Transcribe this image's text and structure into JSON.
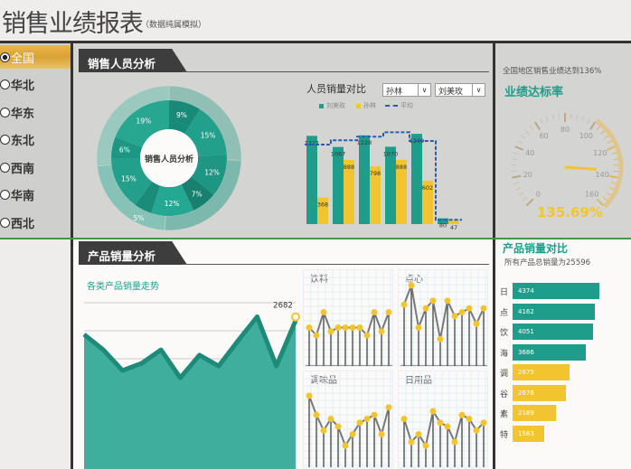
{
  "header": {
    "title": "销售业绩报表",
    "subtitle": "（数据纯属模拟）"
  },
  "sidebar": {
    "regions": [
      {
        "label": "全国",
        "selected": true
      },
      {
        "label": "华北"
      },
      {
        "label": "华东"
      },
      {
        "label": "东北"
      },
      {
        "label": "西南"
      },
      {
        "label": "华南"
      },
      {
        "label": "西北"
      }
    ]
  },
  "sales": {
    "section_title": "销售人员分析",
    "donut": {
      "center_label": "销售人员分析",
      "inner_slices": [
        9,
        15,
        12,
        7,
        12,
        5,
        15,
        6,
        19
      ],
      "labels": [
        "9%",
        "15%",
        "12%",
        "7%",
        "12%",
        "5%",
        "15%",
        "6%",
        "19%"
      ]
    },
    "compare": {
      "title": "人员销量对比",
      "select1": "孙林",
      "select2": "刘美玫",
      "legend": [
        "刘美玫",
        "孙林",
        "平均"
      ],
      "chart_data": {
        "type": "bar",
        "series": [
          {
            "name": "刘美玫",
            "values": [
              1221,
              1067,
              1228,
              1070,
              1249,
              80
            ]
          },
          {
            "name": "孙林",
            "values": [
              368,
              888,
              798,
              888,
              602,
              47
            ]
          },
          {
            "name": "平均",
            "values": [
              1100,
              1160,
              1210,
              1270,
              1150,
              60
            ]
          }
        ]
      }
    }
  },
  "gauge": {
    "caption": "全国地区销售业绩达到136%",
    "title": "业绩达标率",
    "value": 135.69,
    "value_label": "135.69%",
    "ticks": [
      "0",
      "20",
      "40",
      "60",
      "80",
      "100",
      "120",
      "140",
      "160"
    ],
    "max": 160
  },
  "product": {
    "section_title": "产品销量分析",
    "trend_title": "各类产品销量走势",
    "trend_last_label": "2682",
    "chart_data": {
      "type": "area",
      "values": [
        2435,
        2160,
        1790,
        1920,
        2160,
        1660,
        2065,
        1870,
        2320,
        2750,
        1870,
        2682
      ],
      "ylim": [
        0,
        3000
      ]
    },
    "small_multiples": [
      {
        "title": "饮料",
        "values": [
          5,
          4,
          7,
          4.5,
          5,
          5,
          5,
          5,
          4,
          7,
          4.5,
          7
        ]
      },
      {
        "title": "点心",
        "values": [
          8,
          10.5,
          5,
          7.5,
          8.5,
          3.5,
          8.5,
          6.5,
          7,
          7.5,
          5.5,
          7.5
        ]
      },
      {
        "title": "调味品",
        "values": [
          10,
          7.5,
          5.5,
          7,
          6,
          3.5,
          5,
          6.5,
          7,
          7.5,
          5,
          8.5
        ]
      },
      {
        "title": "日用品",
        "values": [
          7,
          4,
          5,
          3.5,
          8,
          6.5,
          6,
          4,
          7.5,
          7,
          5.5,
          6.5
        ]
      }
    ]
  },
  "product_compare": {
    "title": "产品销量对比",
    "subtitle": "所有产品总销量为25596",
    "items": [
      {
        "label": "日",
        "value": 4374
      },
      {
        "label": "点",
        "value": 4162
      },
      {
        "label": "饮",
        "value": 4051
      },
      {
        "label": "海",
        "value": 3686
      },
      {
        "label": "调",
        "value": 2875
      },
      {
        "label": "谷",
        "value": 2676
      },
      {
        "label": "素",
        "value": 2189
      },
      {
        "label": "特",
        "value": 1583
      }
    ]
  },
  "colors": {
    "teal": "#1e9e8a",
    "yellow": "#f2c530",
    "blue": "#2a5db0",
    "gold": "#d9a233"
  }
}
